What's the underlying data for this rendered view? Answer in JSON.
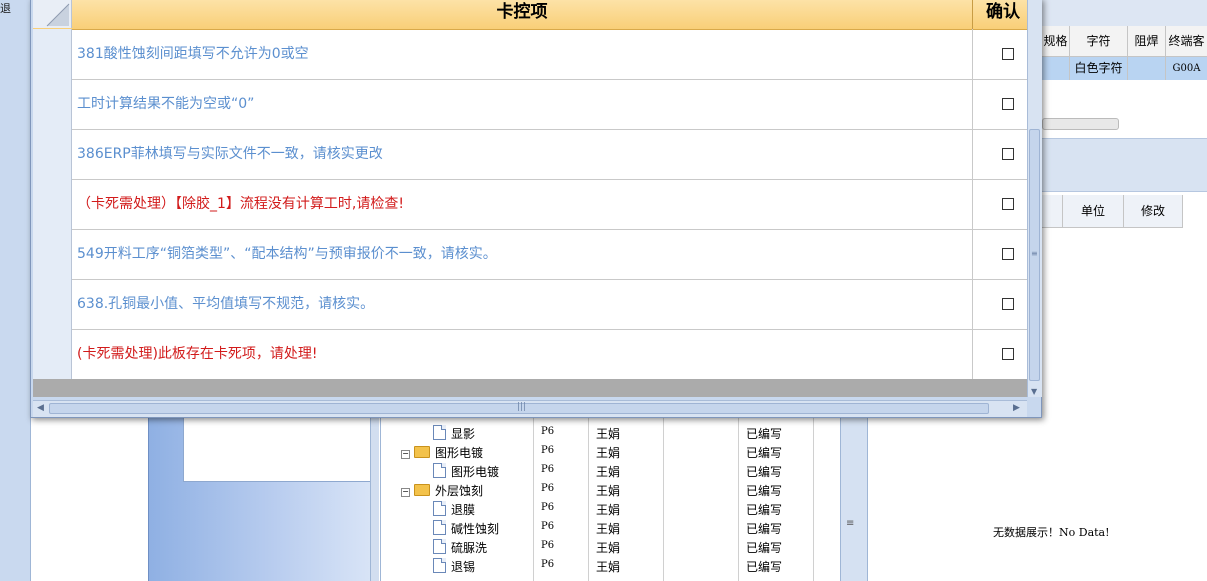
{
  "corner_text": "退",
  "dialog": {
    "header": {
      "item_col": "卡控项",
      "confirm_col": "确认"
    },
    "rows": [
      {
        "text": "381酸性蚀刻间距填写不允许为0或空",
        "style": "normal"
      },
      {
        "text": "工时计算结果不能为空或“0”",
        "style": "normal"
      },
      {
        "text": "386ERP菲林填写与实际文件不一致，请核实更改",
        "style": "normal"
      },
      {
        "text": "（卡死需处理）【除胶_1】流程没有计算工时,请检查!",
        "style": "alert"
      },
      {
        "text": "549开料工序“铜箔类型”、“配本结构”与预审报价不一致，请核实。",
        "style": "normal"
      },
      {
        "text": "638.孔铜最小值、平均值填写不规范，请核实。",
        "style": "normal"
      },
      {
        "text": "(卡死需处理)此板存在卡死项，请处理!",
        "style": "alert"
      }
    ]
  },
  "tree": [
    {
      "name": "显影",
      "type": "doc",
      "version": "P6",
      "user": "王娟",
      "status": "已编写"
    },
    {
      "name": "图形电镀",
      "type": "folder",
      "version": "P6",
      "user": "王娟",
      "status": "已编写"
    },
    {
      "name": "图形电镀",
      "type": "doc",
      "version": "P6",
      "user": "王娟",
      "status": "已编写"
    },
    {
      "name": "外层蚀刻",
      "type": "folder",
      "version": "P6",
      "user": "王娟",
      "status": "已编写"
    },
    {
      "name": "退膜",
      "type": "doc",
      "version": "P6",
      "user": "王娟",
      "status": "已编写"
    },
    {
      "name": "碱性蚀刻",
      "type": "doc",
      "version": "P6",
      "user": "王娟",
      "status": "已编写"
    },
    {
      "name": "硫脲洗",
      "type": "doc",
      "version": "P6",
      "user": "王娟",
      "status": "已编写"
    },
    {
      "name": "退锡",
      "type": "doc",
      "version": "P6",
      "user": "王娟",
      "status": "已编写"
    }
  ],
  "right_grid": {
    "headers": [
      "规格",
      "字符",
      "阻焊",
      "终端客"
    ],
    "row": [
      "",
      "白色字符",
      "",
      "G00A"
    ]
  },
  "right_grid2": {
    "headers": [
      "",
      "单位",
      "修改"
    ]
  },
  "no_data": "无数据展示！No Data!",
  "colors": {
    "normal_text": "#5b8fcf",
    "alert_text": "#d21b1b",
    "header_bg": "#f9cf78"
  }
}
